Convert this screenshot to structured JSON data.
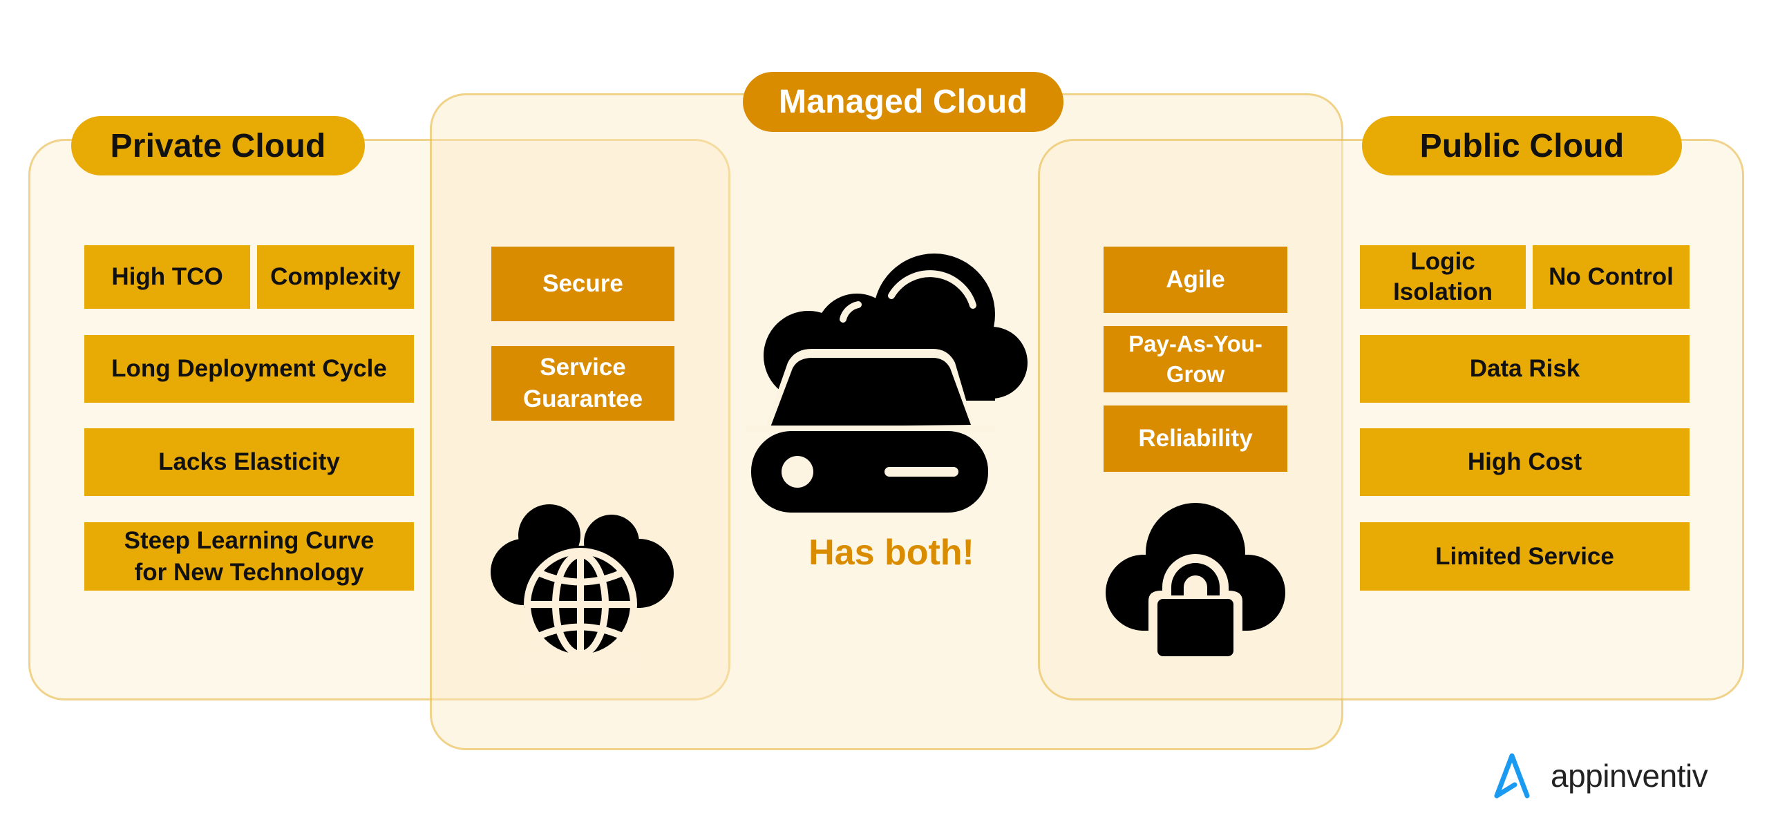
{
  "colors": {
    "con_box": "#e8aa04",
    "pro_box": "#d98c00",
    "panel_border": "#ebc66a",
    "panel_fill": "#fdf3dc",
    "accent_text": "#d98c00",
    "logo_blue": "#1a9af0"
  },
  "private_cloud": {
    "title": "Private Cloud",
    "cons": [
      "High TCO",
      "Complexity",
      "Long Deployment Cycle",
      "Lacks Elasticity",
      "Steep Learning Curve for New Technology"
    ]
  },
  "managed_cloud": {
    "title": "Managed Cloud",
    "private_side_pros": [
      "Secure",
      "Service Guarantee"
    ],
    "public_side_pros": [
      "Agile",
      "Pay-As-You-Grow",
      "Reliability"
    ],
    "center_caption": "Has both!",
    "icons": {
      "private_side": "cloud-globe-icon",
      "center": "cloud-storage-drive-icon",
      "public_side": "cloud-lock-icon"
    }
  },
  "public_cloud": {
    "title": "Public Cloud",
    "cons": [
      "Logic Isolation",
      "No Control",
      "Data Risk",
      "High Cost",
      "Limited Service"
    ]
  },
  "brand": {
    "logo_text": "appinventiv",
    "logo_icon": "appinventiv-a-logo-icon"
  }
}
